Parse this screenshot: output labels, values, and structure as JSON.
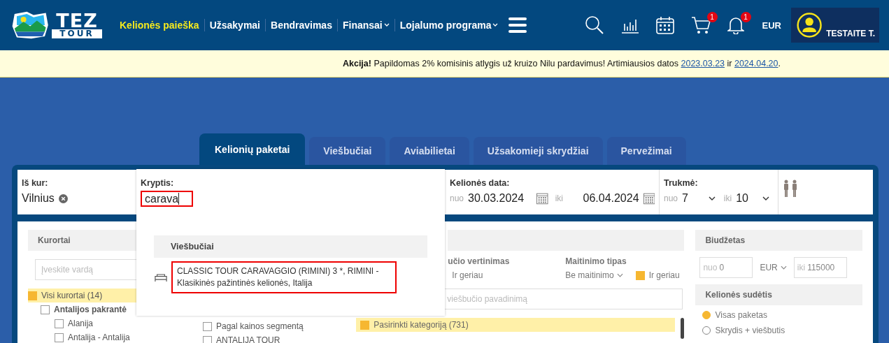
{
  "header": {
    "logo": {
      "line1": "TEZ",
      "line2": "TOUR"
    },
    "nav": [
      {
        "label": "Kelionės paieška",
        "selected": true,
        "dropdown": false
      },
      {
        "label": "Užsakymai",
        "selected": false,
        "dropdown": false
      },
      {
        "label": "Bendravimas",
        "selected": false,
        "dropdown": false
      },
      {
        "label": "Finansai",
        "selected": false,
        "dropdown": true
      },
      {
        "label": "Lojalumo programa",
        "selected": false,
        "dropdown": true
      }
    ],
    "tools": [
      {
        "kind": "search"
      },
      {
        "kind": "chart"
      },
      {
        "kind": "calendar"
      },
      {
        "kind": "cart",
        "badge": "1"
      },
      {
        "kind": "bell",
        "badge": "1"
      }
    ],
    "currency": "EUR",
    "user": "TESTAITE T."
  },
  "notice": {
    "lead": "Akcija!",
    "text": "Papildomas 2% komisinis atlygis už kruizo Nilu pardavimus! Artimiausios datos",
    "links": [
      "2023.03.23",
      "2024.04.20"
    ],
    "joiner": "ir",
    "end": "."
  },
  "tabs": [
    {
      "label": "Kelionių paketai",
      "selected": true
    },
    {
      "label": "Viešbučiai",
      "selected": false
    },
    {
      "label": "Aviabilietai",
      "selected": false
    },
    {
      "label": "Užsakomieji skrydžiai",
      "selected": false
    },
    {
      "label": "Pervežimai",
      "selected": false
    }
  ],
  "fields": {
    "from": {
      "label": "Iš kur:",
      "value": "Vilnius"
    },
    "date": {
      "label": "Kelionės data:",
      "from_prefix": "nuo",
      "from": "30.03.2024",
      "to_prefix": "iki",
      "to": "06.04.2024"
    },
    "duration": {
      "label": "Trukmė:",
      "from_prefix": "nuo",
      "from": "7",
      "to_prefix": "iki",
      "to": "10"
    }
  },
  "dropdown": {
    "label": "Kryptis:",
    "value": "carava",
    "group": "Viešbučiai",
    "results": [
      {
        "text": "CLASSIC TOUR CARAVAGGIO (RIMINI) 3 *, RIMINI - Klasikinės pažintinės kelionės, Italija"
      }
    ]
  },
  "filters": {
    "resorts": {
      "title": "Kurortai",
      "placeholder": "Įveskite vardą",
      "items": [
        {
          "label": "Visi kurortai (14)",
          "checked": true
        },
        {
          "label": "Antalijos pakrantė",
          "checked": false
        },
        {
          "label": "Alanija",
          "checked": false
        },
        {
          "label": "Antalija - Antalija",
          "checked": false
        }
      ],
      "side_items": [
        {
          "label": "Pagal kainos segmentą",
          "checked": false
        },
        {
          "label": "ANTALIJA TOUR",
          "checked": false
        }
      ]
    },
    "hotels": {
      "rating_label": "učio vertinimas",
      "rating_option": "Ir geriau",
      "meal_label": "Maitinimo tipas",
      "meal_value": "Be maitinimo",
      "meal_better": {
        "label": "Ir geriau",
        "checked": true
      },
      "name_placeholder": "viešbučio pavadinimą",
      "category": "Pasirinkti kategoriją (731)"
    },
    "budget": {
      "title": "Biudžetas",
      "from_prefix": "nuo",
      "from": "0",
      "currency": "EUR",
      "to_prefix": "iki",
      "to": "115000"
    },
    "composition": {
      "title": "Kelionės sudėtis",
      "options": [
        {
          "label": "Visas paketas",
          "selected": true
        },
        {
          "label": "Skrydis + viešbutis",
          "selected": false
        }
      ]
    }
  }
}
